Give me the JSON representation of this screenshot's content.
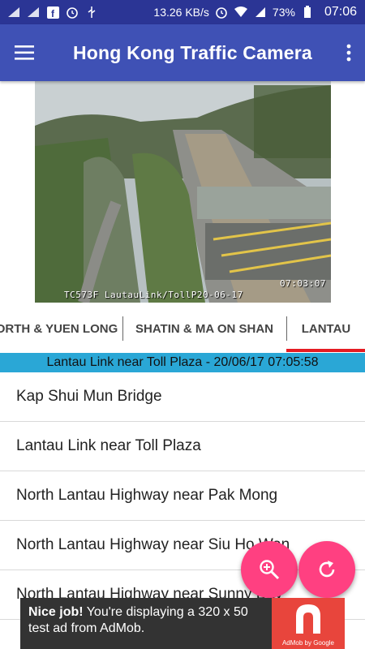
{
  "status_bar": {
    "net_speed": "13.26 KB/s",
    "battery": "73%",
    "time": "07:06"
  },
  "app_bar": {
    "title": "Hong Kong Traffic Camera"
  },
  "camera": {
    "caption_time": "07:03:07",
    "caption_id": "TC573F LautauLink/TollP20-06-17"
  },
  "tabs": [
    {
      "label": "ORTH & YUEN LONG"
    },
    {
      "label": "SHATIN & MA ON SHAN"
    },
    {
      "label": "LANTAU"
    }
  ],
  "selected_tab": "LANTAU",
  "status_line": "Lantau Link near Toll Plaza - 20/06/17 07:05:58",
  "list_items": [
    "Kap Shui Mun Bridge",
    "Lantau Link near Toll Plaza",
    "North Lantau Highway near Pak Mong",
    "North Lantau Highway near Siu Ho Wan",
    "North Lantau Highway near Sunny Bay"
  ],
  "ad": {
    "headline": "Nice job!",
    "body": "You're displaying a 320 x 50 test ad from AdMob.",
    "logo_caption": "AdMob by Google"
  },
  "colors": {
    "app_bar": "#3f51b5",
    "status_bar": "#2b3595",
    "fab": "#ff4081",
    "tab_indicator": "#e51c23",
    "status_line_bg": "#2aa7d6"
  },
  "icons": {
    "menu": "hamburger-menu-icon",
    "more": "more-vert-icon",
    "zoom": "zoom-in-icon",
    "refresh": "refresh-icon"
  }
}
